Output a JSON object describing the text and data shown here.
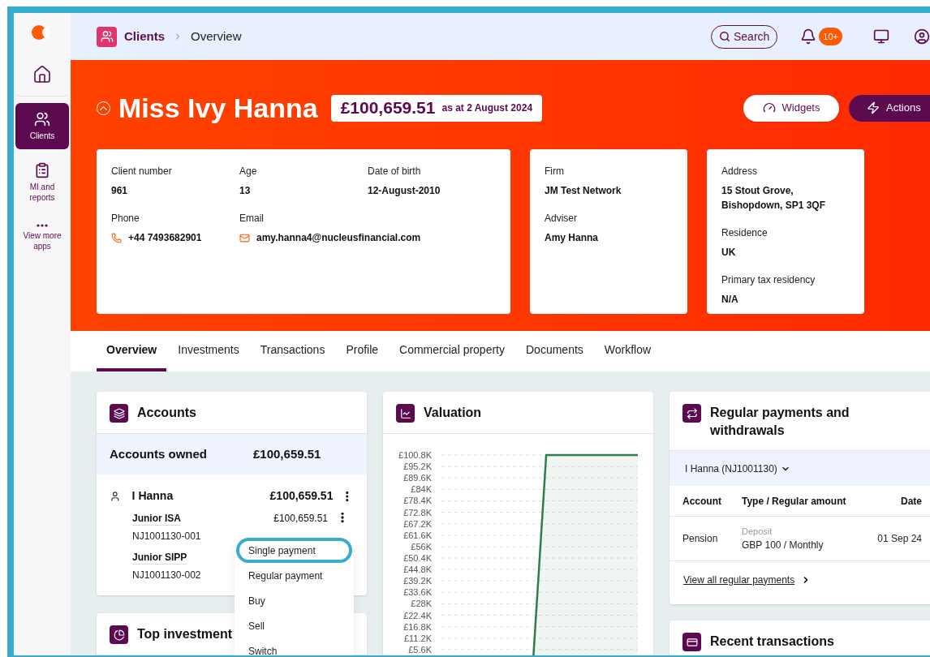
{
  "sidebar": {
    "items": [
      {
        "kind": "home",
        "selected": false
      },
      {
        "kind": "clients",
        "label": "Clients",
        "selected": true
      },
      {
        "kind": "reports",
        "label": "MI and reports",
        "selected": false
      },
      {
        "kind": "more",
        "label": "View more apps",
        "selected": false
      }
    ]
  },
  "topbar": {
    "breadcrumb": [
      "Clients",
      "Overview"
    ],
    "search": "Search",
    "notifications": "10+"
  },
  "client": {
    "name": "Miss Ivy Hanna",
    "total": "£100,659.51",
    "as_at": "as at 2 August 2024",
    "buttons": [
      "Widgets",
      "Actions"
    ]
  },
  "details": {
    "personal": [
      {
        "label": "Client number",
        "value": "961"
      },
      {
        "label": "Age",
        "value": "13"
      },
      {
        "label": "Date of birth",
        "value": "12-August-2010"
      },
      {
        "label": "Phone",
        "value": "+44 7493682901",
        "kind": "phone"
      },
      {
        "label": "Email",
        "value": "amy.hanna4@nucleusfinancial.com",
        "kind": "email"
      }
    ],
    "firm": [
      {
        "label": "Firm",
        "value": "JM Test Network"
      },
      {
        "label": "Adviser",
        "value": "Amy Hanna"
      }
    ],
    "address": [
      {
        "label": "Address",
        "value": "15 Stout Grove, Bishopdown, SP1 3QF"
      },
      {
        "label": "Residence",
        "value": "UK"
      },
      {
        "label": "Primary tax residency",
        "value": "N/A"
      }
    ]
  },
  "tabs": [
    {
      "label": "Overview",
      "selected": true
    },
    {
      "label": "Investments",
      "selected": false
    },
    {
      "label": "Transactions",
      "selected": false
    },
    {
      "label": "Profile",
      "selected": false
    },
    {
      "label": "Commercial property",
      "selected": false
    },
    {
      "label": "Documents",
      "selected": false
    },
    {
      "label": "Workflow",
      "selected": false
    }
  ],
  "accounts": {
    "title": "Accounts",
    "owned_label": "Accounts owned",
    "owned_total": "£100,659.51",
    "holder": {
      "name": "I Hanna",
      "total": "£100,659.51"
    },
    "items": [
      {
        "name": "Junior ISA",
        "number": "NJ1001130-001",
        "value": "£100,659.51"
      },
      {
        "name": "Junior SIPP",
        "number": "NJ1001130-002"
      }
    ],
    "menu": [
      {
        "label": "Single payment",
        "highlighted": true
      },
      {
        "label": "Regular payment",
        "highlighted": false
      },
      {
        "label": "Buy",
        "highlighted": false
      },
      {
        "label": "Sell",
        "highlighted": false
      },
      {
        "label": "Switch",
        "highlighted": false
      }
    ]
  },
  "top_investments": {
    "title": "Top investment"
  },
  "valuation": {
    "title": "Valuation",
    "chart_data": {
      "type": "area",
      "categories": [
        null,
        null,
        null,
        null,
        null,
        null,
        null,
        null,
        null,
        null,
        null,
        null,
        null,
        null,
        null,
        null
      ],
      "ylim": [
        0,
        100800
      ],
      "grid": true,
      "yticks": [
        {
          "value": 100800,
          "label": "£100.8K"
        },
        {
          "value": 95200,
          "label": "£95.2K"
        },
        {
          "value": 89600,
          "label": "£89.6K"
        },
        {
          "value": 84000,
          "label": "£84K"
        },
        {
          "value": 78400,
          "label": "£78.4K"
        },
        {
          "value": 72800,
          "label": "£72.8K"
        },
        {
          "value": 67200,
          "label": "£67.2K"
        },
        {
          "value": 61600,
          "label": "£61.6K"
        },
        {
          "value": 56000,
          "label": "£56K"
        },
        {
          "value": 50400,
          "label": "£50.4K"
        },
        {
          "value": 44800,
          "label": "£44.8K"
        },
        {
          "value": 39200,
          "label": "£39.2K"
        },
        {
          "value": 33600,
          "label": "£33.6K"
        },
        {
          "value": 28000,
          "label": "£28K"
        },
        {
          "value": 22400,
          "label": "£22.4K"
        },
        {
          "value": 16800,
          "label": "£16.8K"
        },
        {
          "value": 11200,
          "label": "£11.2K"
        },
        {
          "value": 5600,
          "label": "£5.6K"
        }
      ],
      "series": [
        {
          "color": "#2e7d4f",
          "values": [
            null,
            null,
            null,
            null,
            null,
            null,
            null,
            0,
            100800,
            100800,
            100800,
            100800,
            100800,
            100800,
            100800,
            100800
          ]
        }
      ]
    }
  },
  "regular_payments": {
    "title": "Regular payments and withdrawals",
    "selector": "I Hanna (NJ1001130)",
    "columns": [
      "Account",
      "Type / Regular amount",
      "Date"
    ],
    "rows": [
      {
        "account": "Pension",
        "type": "Deposit",
        "amount": "GBP 100 / Monthly",
        "date": "01 Sep 24"
      }
    ],
    "link": "View all regular payments"
  },
  "recent_transactions": {
    "title": "Recent transactions"
  }
}
